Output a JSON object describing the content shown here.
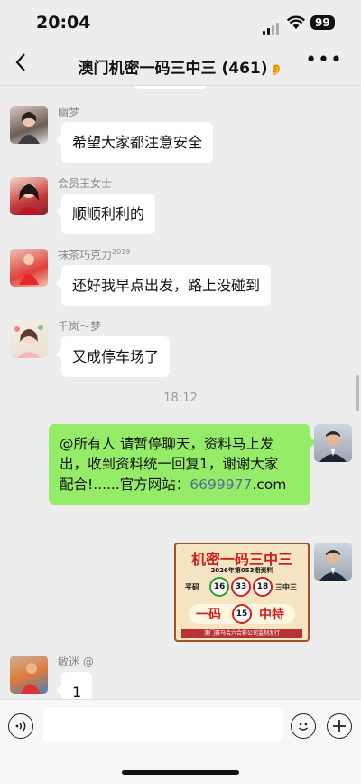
{
  "status": {
    "time": "20:04",
    "battery": "99"
  },
  "header": {
    "title": "澳门机密一码三中三 (461)"
  },
  "messages": [
    {
      "nick": "幽梦",
      "text": "希望大家都注意安全"
    },
    {
      "nick": "会员王女士",
      "text": "顺顺利利的"
    },
    {
      "nick": "抹茶巧克力",
      "nick_sup": "2019",
      "text": "还好我早点出发，路上没碰到"
    },
    {
      "nick": "千岚～梦",
      "text": "又成停车场了"
    },
    {
      "nick": "敏迷 @",
      "text": "1"
    }
  ],
  "timestamp": "18:12",
  "announcement": {
    "line1": "@所有人 请暂停聊天，资料马上发",
    "line2": "出，收到资料统一回复1，谢谢大家",
    "line3_prefix": "配合!......官方网站：",
    "link": "6699977",
    "line3_suffix": ".com"
  },
  "poster": {
    "title": "机密一码三中三",
    "issue": "2026年第053期资料",
    "left_label": "平码",
    "right_label": "三中三",
    "balls": [
      "16",
      "33",
      "18"
    ],
    "special_ball": "15",
    "big_left": "一码",
    "big_right": "中特",
    "footer": "澳门赛马会六合彩公司监制发行"
  },
  "icons": {
    "back": "chevron-left-icon",
    "more": "ellipsis-icon",
    "voice": "voice-icon",
    "emoji": "emoji-icon",
    "add": "plus-icon"
  }
}
